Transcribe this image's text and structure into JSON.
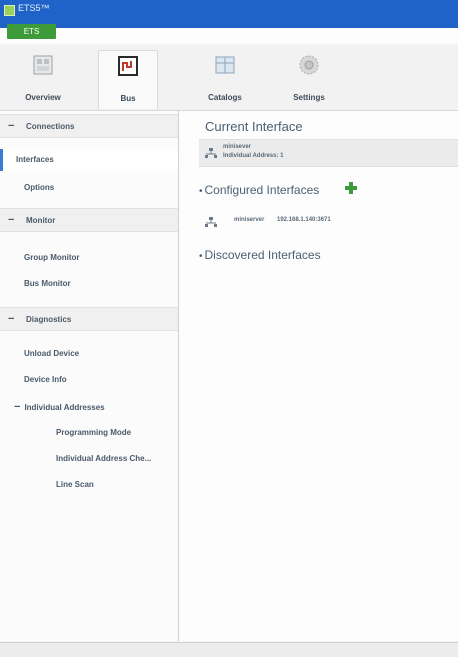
{
  "window": {
    "title": "ETS5™",
    "badge": "ETS"
  },
  "ribbon": {
    "tabs": [
      {
        "label": "Overview",
        "icon": "overview-icon"
      },
      {
        "label": "Bus",
        "icon": "bus-icon",
        "active": true
      },
      {
        "label": "Catalogs",
        "icon": "catalogs-icon"
      },
      {
        "label": "Settings",
        "icon": "settings-icon"
      }
    ]
  },
  "nav": {
    "connections": {
      "label": "Connections",
      "toggle": "−"
    },
    "interfaces": "Interfaces",
    "options": "Options",
    "monitor": {
      "label": "Monitor",
      "toggle": "−"
    },
    "group_monitor": "Group Monitor",
    "bus_monitor": "Bus Monitor",
    "diagnostics": {
      "label": "Diagnostics",
      "toggle": "−"
    },
    "unload_device": "Unload Device",
    "device_info": "Device Info",
    "individual_addresses": {
      "label": "Individual Addresses",
      "toggle": "−"
    },
    "programming_mode": "Programming Mode",
    "individual_address_check": "Individual Address Che...",
    "line_scan": "Line Scan"
  },
  "main": {
    "current_title": "Current Interface",
    "current_name": "minisever",
    "current_address": "Individual Address: 1",
    "configured_title": "Configured Interfaces",
    "configured_item": {
      "name": "miniserver",
      "ip": "192.168.1.140:3671"
    },
    "discovered_title": "Discovered Interfaces",
    "bullet": "•",
    "accent_green": "#3e9b3a"
  }
}
